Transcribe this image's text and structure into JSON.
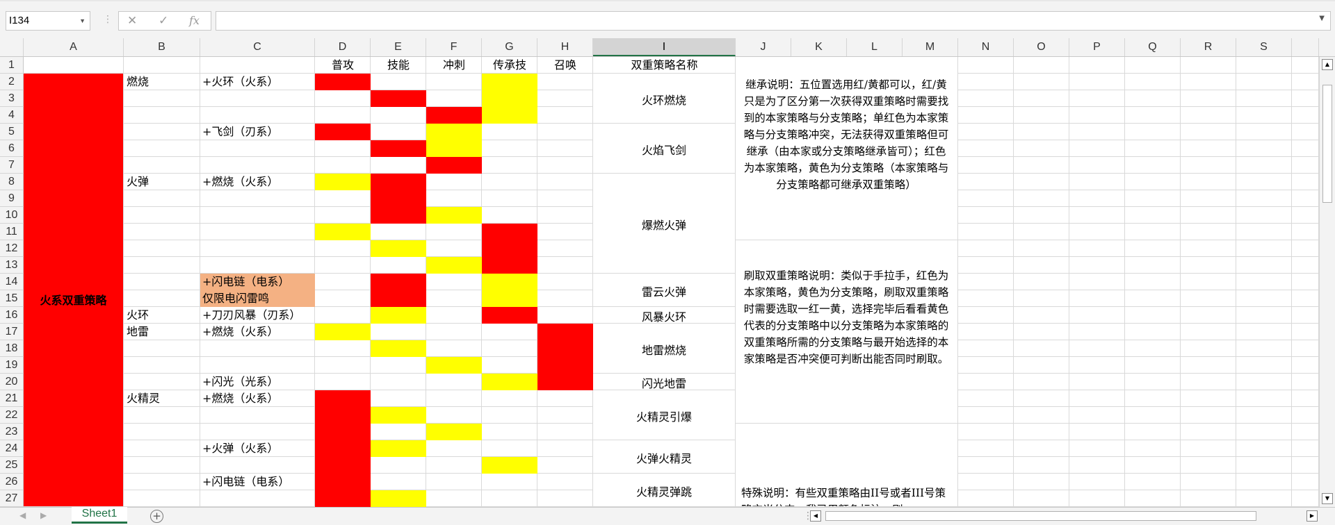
{
  "formula_bar": {
    "name_box": "I134",
    "cancel_icon": "✕",
    "enter_icon": "✓",
    "fx_label": "fx",
    "formula": ""
  },
  "columns": [
    "A",
    "B",
    "C",
    "D",
    "E",
    "F",
    "G",
    "H",
    "I",
    "J",
    "K",
    "L",
    "M",
    "N",
    "O",
    "P",
    "Q",
    "R",
    "S"
  ],
  "selected_column": "I",
  "rows": [
    "1",
    "2",
    "3",
    "4",
    "5",
    "6",
    "7",
    "8",
    "9",
    "10",
    "11",
    "12",
    "13",
    "14",
    "15",
    "16",
    "17",
    "18",
    "19",
    "20",
    "21",
    "22",
    "23",
    "24",
    "25",
    "26",
    "27"
  ],
  "colors": {
    "red": "#ff0000",
    "yellow": "#ffff00",
    "orange": "#f4b183",
    "accent": "#217346"
  },
  "grid": {
    "header": {
      "D": "普攻",
      "E": "技能",
      "F": "冲刺",
      "G": "传承技",
      "H": "召唤",
      "I": "双重策略名称"
    },
    "a_merged": "火系双重策略",
    "b": {
      "2": "燃烧",
      "8": "火弹",
      "16": "火环",
      "17": "地雷",
      "21": "火精灵"
    },
    "c": {
      "2": "+火环（火系）",
      "5": "+飞剑（刃系）",
      "8": "+燃烧（火系）",
      "14": "+闪电链（电系）",
      "15": "仅限电闪雷鸣",
      "16": "+刀刃风暴（刃系）",
      "17": "+燃烧（火系）",
      "20": "+闪光（光系）",
      "21": "+燃烧（火系）",
      "24": "+火弹（火系）",
      "26": "+闪电链（电系）"
    },
    "strategy_names": [
      {
        "rows": "2-4",
        "name": "火环燃烧"
      },
      {
        "rows": "5-7",
        "name": "火焰飞剑"
      },
      {
        "rows": "8-13",
        "name": "爆燃火弹"
      },
      {
        "rows": "14-15",
        "name": "雷云火弹"
      },
      {
        "rows": "16",
        "name": "风暴火环"
      },
      {
        "rows": "17-19",
        "name": "地雷燃烧"
      },
      {
        "rows": "20",
        "name": "闪光地雷"
      },
      {
        "rows": "21-23",
        "name": "火精灵引爆"
      },
      {
        "rows": "24-25",
        "name": "火弹火精灵"
      },
      {
        "rows": "26-27",
        "name": "火精灵弹跳"
      }
    ],
    "fills": [
      [
        "D",
        2,
        "red"
      ],
      [
        "G",
        2,
        "yellow"
      ],
      [
        "E",
        3,
        "red"
      ],
      [
        "G",
        3,
        "yellow"
      ],
      [
        "F",
        4,
        "red"
      ],
      [
        "G",
        4,
        "yellow"
      ],
      [
        "D",
        5,
        "red"
      ],
      [
        "F",
        5,
        "yellow"
      ],
      [
        "E",
        6,
        "red"
      ],
      [
        "F",
        6,
        "yellow"
      ],
      [
        "F",
        7,
        "red"
      ],
      [
        "D",
        8,
        "yellow"
      ],
      [
        "E",
        8,
        "red"
      ],
      [
        "E",
        9,
        "red"
      ],
      [
        "E",
        10,
        "red"
      ],
      [
        "F",
        10,
        "yellow"
      ],
      [
        "D",
        11,
        "yellow"
      ],
      [
        "G",
        11,
        "red"
      ],
      [
        "E",
        12,
        "yellow"
      ],
      [
        "G",
        12,
        "red"
      ],
      [
        "F",
        13,
        "yellow"
      ],
      [
        "G",
        13,
        "red"
      ],
      [
        "E",
        14,
        "red"
      ],
      [
        "G",
        14,
        "yellow"
      ],
      [
        "E",
        15,
        "red"
      ],
      [
        "G",
        15,
        "yellow"
      ],
      [
        "E",
        16,
        "yellow"
      ],
      [
        "G",
        16,
        "red"
      ],
      [
        "D",
        17,
        "yellow"
      ],
      [
        "H",
        17,
        "red"
      ],
      [
        "E",
        18,
        "yellow"
      ],
      [
        "H",
        18,
        "red"
      ],
      [
        "F",
        19,
        "yellow"
      ],
      [
        "H",
        19,
        "red"
      ],
      [
        "G",
        20,
        "yellow"
      ],
      [
        "H",
        20,
        "red"
      ],
      [
        "D",
        21,
        "red"
      ],
      [
        "D",
        22,
        "red"
      ],
      [
        "E",
        22,
        "yellow"
      ],
      [
        "D",
        23,
        "red"
      ],
      [
        "F",
        23,
        "yellow"
      ],
      [
        "D",
        24,
        "red"
      ],
      [
        "E",
        24,
        "yellow"
      ],
      [
        "D",
        25,
        "red"
      ],
      [
        "G",
        25,
        "yellow"
      ],
      [
        "D",
        26,
        "red"
      ],
      [
        "D",
        27,
        "red"
      ],
      [
        "E",
        27,
        "yellow"
      ],
      [
        "G",
        28,
        "yellow"
      ]
    ],
    "c_fills": [
      [
        "C",
        14,
        "orange"
      ],
      [
        "C",
        15,
        "orange"
      ]
    ],
    "notes": {
      "inherit": "继承说明：五位置选用红/黄都可以，红/黄只是为了区分第一次获得双重策略时需要找到的本家策略与分支策略；单红色为本家策略与分支策略冲突，无法获得双重策略但可继承（由本家或分支策略继承皆可）；红色为本家策略，黄色为分支策略（本家策略与分支策略都可继承双重策略）",
      "refresh": "刷取双重策略说明：类似于手拉手，红色为本家策略，黄色为分支策略，刷取双重策略时需要选取一红一黄，选择完毕后看看黄色代表的分支策略中以分支策略为本家策略的双重策略所需的分支策略与最开始选择的本家策略是否冲突便可判断出能否同时刷取。",
      "special": "特殊说明：有些双重策略由II号或者III号策略充当分支，我已用颜色标注，刷"
    }
  },
  "sheet_tab": "Sheet1",
  "add_sheet_icon": "⊕"
}
